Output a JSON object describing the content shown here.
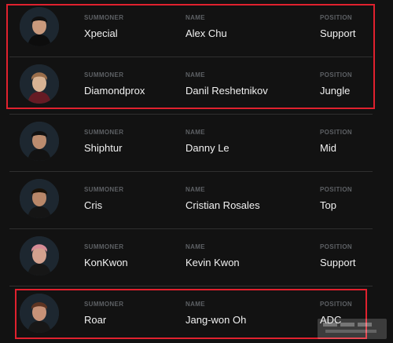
{
  "roster": {
    "labels": {
      "summoner": "SUMMONER",
      "name": "NAME",
      "position": "POSITION"
    },
    "players": [
      {
        "summoner": "Xpecial",
        "name": "Alex Chu",
        "position": "Support",
        "avatar": "player-portrait"
      },
      {
        "summoner": "Diamondprox",
        "name": "Danil Reshetnikov",
        "position": "Jungle",
        "avatar": "player-portrait"
      },
      {
        "summoner": "Shiphtur",
        "name": "Danny Le",
        "position": "Mid",
        "avatar": "player-portrait"
      },
      {
        "summoner": "Cris",
        "name": "Cristian Rosales",
        "position": "Top",
        "avatar": "player-portrait"
      },
      {
        "summoner": "KonKwon",
        "name": "Kevin Kwon",
        "position": "Support",
        "avatar": "player-portrait"
      },
      {
        "summoner": "Roar",
        "name": "Jang-won Oh",
        "position": "ADC",
        "avatar": "player-portrait"
      }
    ]
  },
  "theme": {
    "background": "#121212",
    "divider": "#2f2f2f",
    "label": "#5d6064",
    "text": "#f1f1f1",
    "highlight": "#e0212e"
  }
}
